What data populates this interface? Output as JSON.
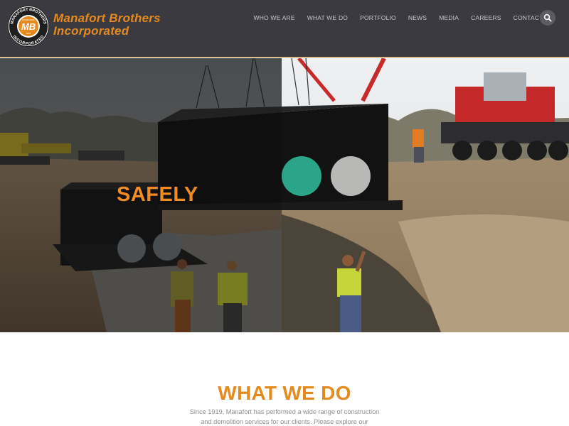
{
  "brand": {
    "name_line1": "Manafort Brothers",
    "name_line2": "Incorporated",
    "seal_top": "MANAFORT BROTHERS",
    "seal_bottom": "INCORPORATED",
    "seal_mark": "MB",
    "seal_left": "ESTABLISHED",
    "seal_right": "1919",
    "accent_color": "#e58a1f"
  },
  "nav": {
    "items": [
      {
        "label": "WHO WE ARE"
      },
      {
        "label": "WHAT WE DO"
      },
      {
        "label": "PORTFOLIO"
      },
      {
        "label": "NEWS"
      },
      {
        "label": "MEDIA"
      },
      {
        "label": "CAREERS"
      },
      {
        "label": "CONTACT"
      }
    ],
    "search_icon": "search-icon"
  },
  "hero": {
    "tagline": "SAFELY"
  },
  "what_we_do": {
    "title": "WHAT WE DO",
    "body": "Since 1919, Manafort has performed a wide range of construction and demolition services for our clients. Please explore our"
  }
}
